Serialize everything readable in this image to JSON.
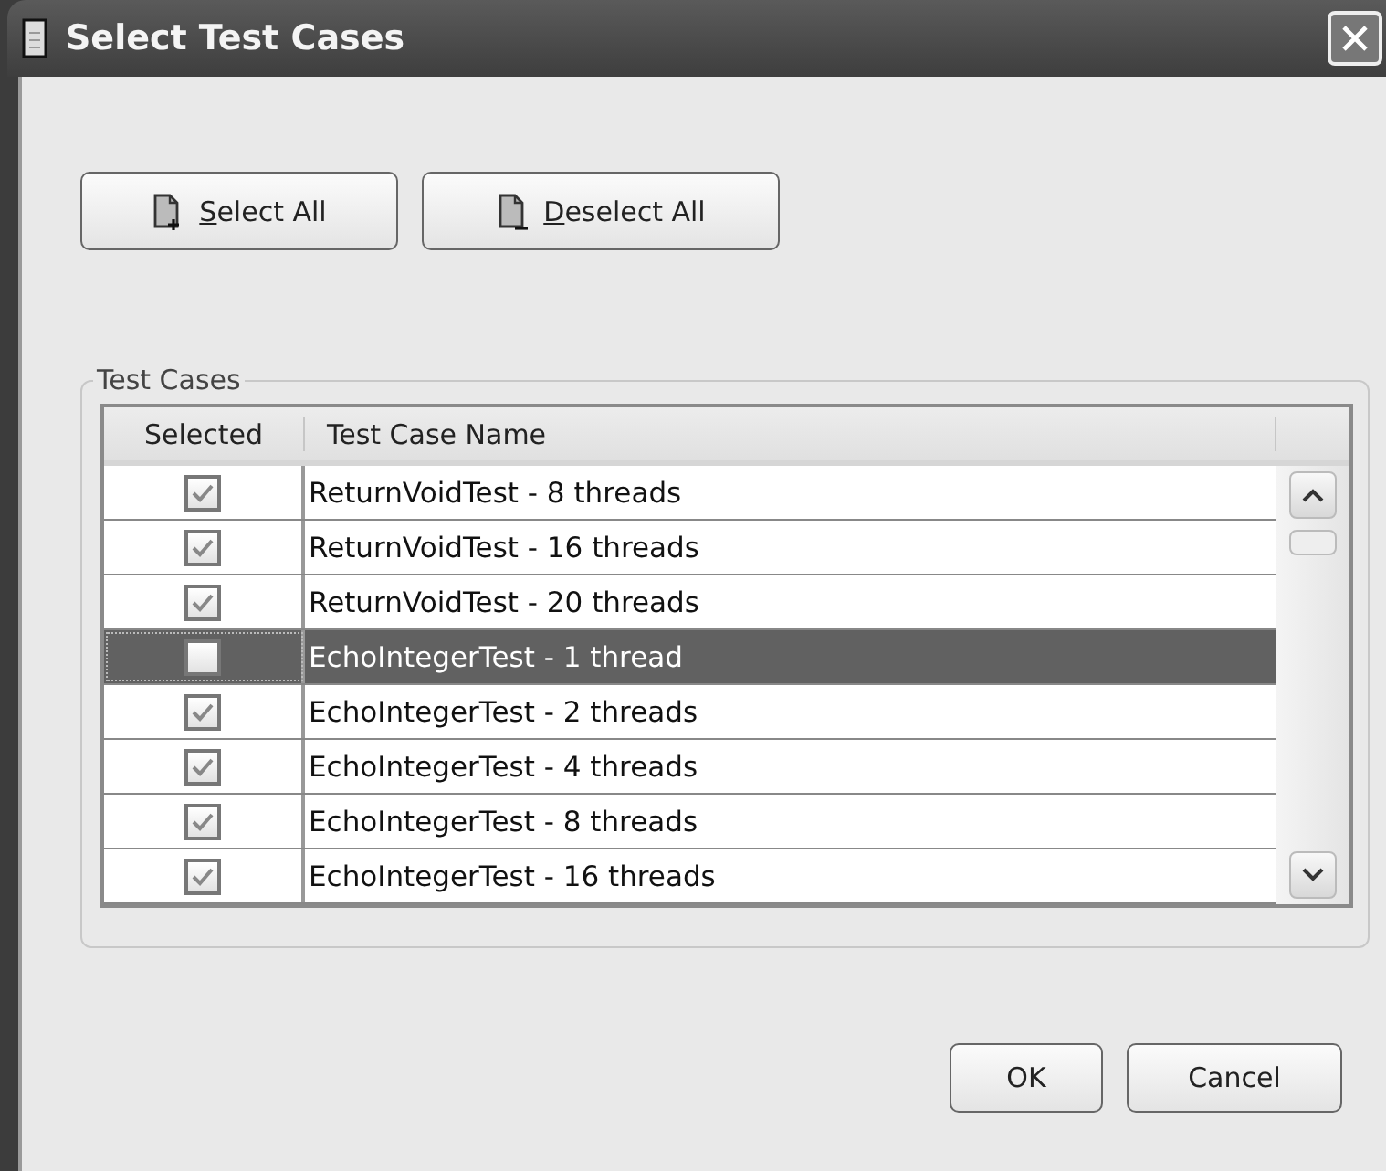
{
  "window": {
    "title": "Select Test Cases"
  },
  "top_buttons": [
    {
      "label": "Select All",
      "kind": "add"
    },
    {
      "label": "Deselect All",
      "kind": "remove"
    }
  ],
  "group": {
    "title": "Test Cases"
  },
  "table": {
    "columns": [
      "Selected",
      "Test Case Name"
    ],
    "rows": [
      {
        "name": "ReturnVoidTest - 8 threads",
        "checked": true,
        "selected": false
      },
      {
        "name": "ReturnVoidTest - 16 threads",
        "checked": true,
        "selected": false
      },
      {
        "name": "ReturnVoidTest - 20 threads",
        "checked": true,
        "selected": false
      },
      {
        "name": "EchoIntegerTest - 1 thread",
        "checked": false,
        "selected": true
      },
      {
        "name": "EchoIntegerTest - 2 threads",
        "checked": true,
        "selected": false
      },
      {
        "name": "EchoIntegerTest - 4 threads",
        "checked": true,
        "selected": false
      },
      {
        "name": "EchoIntegerTest - 8 threads",
        "checked": true,
        "selected": false
      },
      {
        "name": "EchoIntegerTest - 16 threads",
        "checked": true,
        "selected": false
      }
    ]
  },
  "buttons": [
    "OK",
    "Cancel"
  ]
}
